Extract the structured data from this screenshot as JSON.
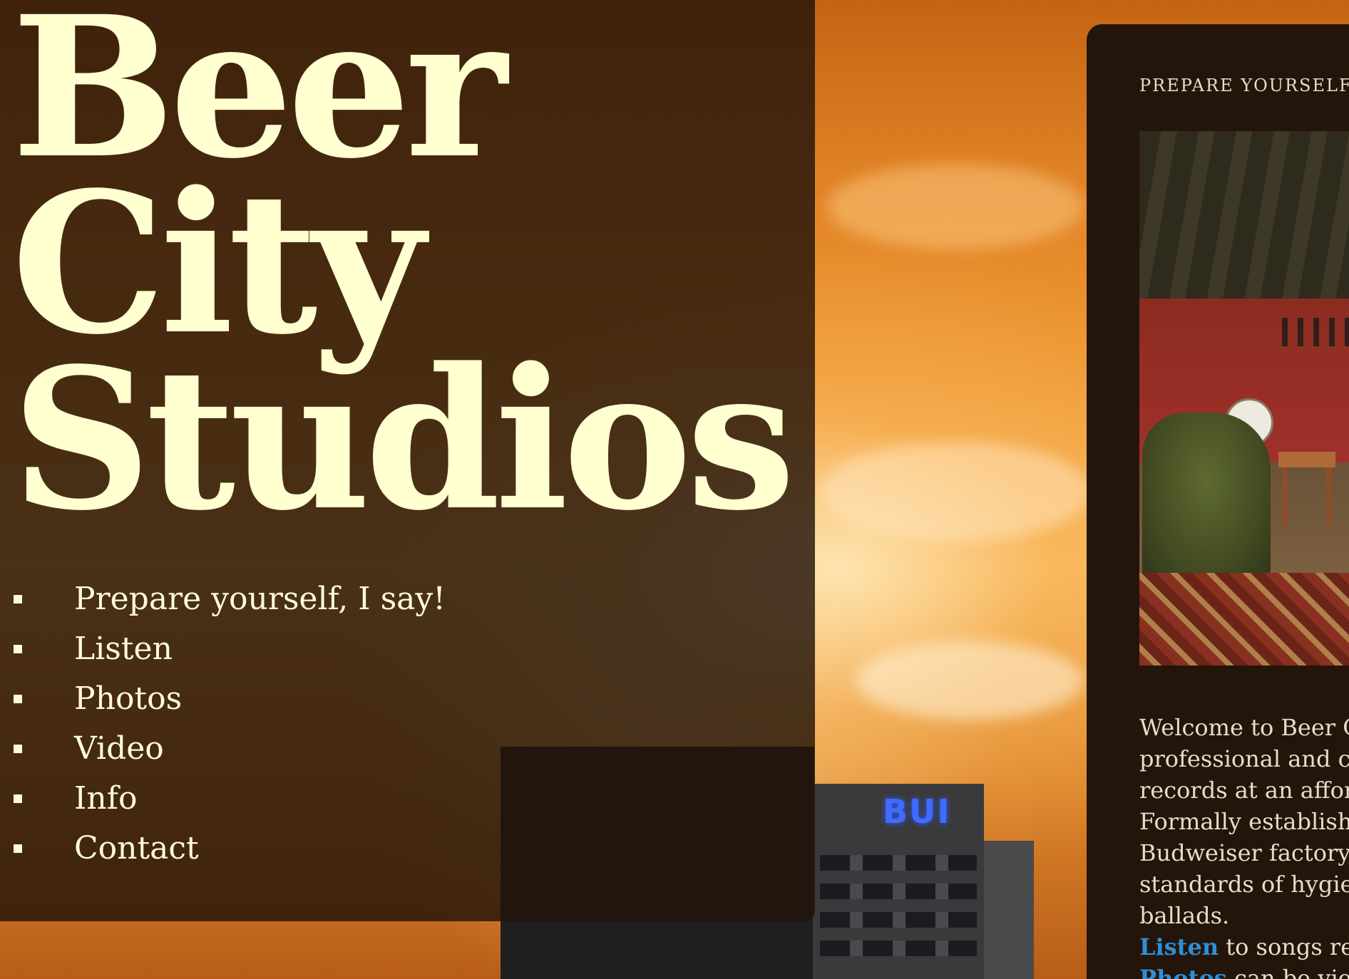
{
  "site": {
    "title_lines": [
      "Beer",
      "City",
      "Studios"
    ]
  },
  "nav": {
    "items": [
      {
        "label": "Prepare yourself, I say!"
      },
      {
        "label": "Listen"
      },
      {
        "label": "Photos"
      },
      {
        "label": "Video"
      },
      {
        "label": "Info"
      },
      {
        "label": "Contact"
      }
    ]
  },
  "background": {
    "sign_text": "BUI"
  },
  "main": {
    "section_title": "PREPARE YOURSELF,",
    "intro_lines": [
      "Welcome to Beer C",
      "professional and co",
      "records at an afford",
      "Formally establishe",
      "Budweiser factory, ",
      "standards of hygien",
      "ballads."
    ],
    "listen_link": "Listen",
    "listen_text": " to songs rec",
    "photos_link": "Photos",
    "photos_text": " can be vie"
  },
  "colors": {
    "title": "#ffffd0",
    "panel": "#23150a",
    "link": "#2f8fd8",
    "sky_orange": "#e08226"
  }
}
